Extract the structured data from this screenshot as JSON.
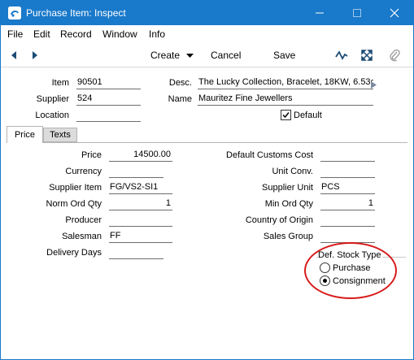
{
  "window": {
    "title": "Purchase Item: Inspect"
  },
  "menu": [
    "File",
    "Edit",
    "Record",
    "Window",
    "Info"
  ],
  "toolbar": {
    "create_label": "Create",
    "cancel_label": "Cancel",
    "save_label": "Save"
  },
  "header": {
    "item_label": "Item",
    "item_value": "90501",
    "supplier_label": "Supplier",
    "supplier_value": "524",
    "location_label": "Location",
    "location_value": "",
    "desc_label": "Desc.",
    "desc_value": "The Lucky Collection, Bracelet, 18KW, 6.53ct",
    "name_label": "Name",
    "name_value": "Mauritez Fine Jewellers",
    "default_label": "Default",
    "default_checked": true
  },
  "tabs": [
    {
      "label": "Price",
      "active": true
    },
    {
      "label": "Texts",
      "active": false
    }
  ],
  "price_tab": {
    "price_label": "Price",
    "price_value": "14500.00",
    "currency_label": "Currency",
    "currency_value": "",
    "supplier_item_label": "Supplier Item",
    "supplier_item_value": "FG/VS2-SI1",
    "norm_ord_qty_label": "Norm Ord Qty",
    "norm_ord_qty_value": "1",
    "producer_label": "Producer",
    "producer_value": "",
    "salesman_label": "Salesman",
    "salesman_value": "FF",
    "delivery_days_label": "Delivery Days",
    "delivery_days_value": "",
    "default_customs_cost_label": "Default Customs Cost",
    "default_customs_cost_value": "",
    "unit_conv_label": "Unit Conv.",
    "unit_conv_value": "",
    "supplier_unit_label": "Supplier Unit",
    "supplier_unit_value": "PCS",
    "min_ord_qty_label": "Min Ord Qty",
    "min_ord_qty_value": "1",
    "country_of_origin_label": "Country of Origin",
    "country_of_origin_value": "",
    "sales_group_label": "Sales Group",
    "sales_group_value": ""
  },
  "stock_type": {
    "title": "Def. Stock Type",
    "options": [
      {
        "label": "Purchase",
        "selected": false
      },
      {
        "label": "Consignment",
        "selected": true
      }
    ]
  },
  "colors": {
    "titlebar": "#1979ca",
    "highlight_ellipse": "#d81b1b"
  }
}
